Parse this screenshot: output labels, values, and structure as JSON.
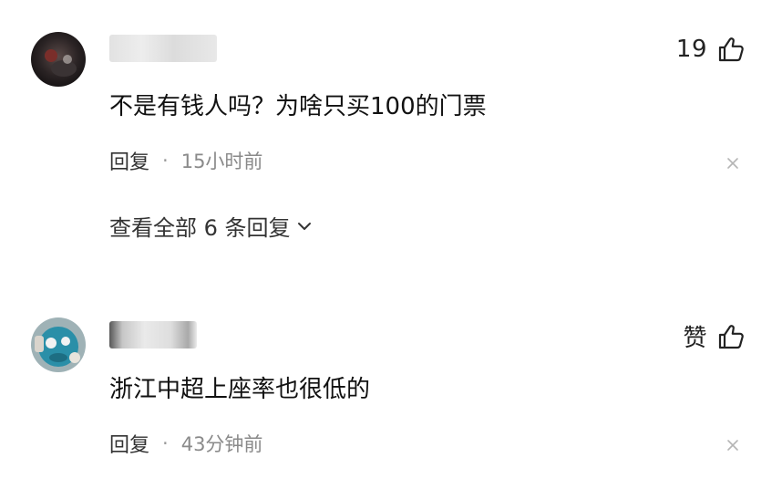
{
  "comments": [
    {
      "like_count": "19",
      "text": "不是有钱人吗？为啥只买100的门票",
      "reply_label": "回复",
      "dot": "·",
      "time": "15小时前",
      "view_replies": "查看全部 6 条回复"
    },
    {
      "like_label": "赞",
      "text": "浙江中超上座率也很低的",
      "reply_label": "回复",
      "dot": "·",
      "time": "43分钟前"
    }
  ],
  "icons": {
    "like": "thumbs-up-icon",
    "close": "close-icon",
    "expand": "chevron-down-icon"
  },
  "colors": {
    "text": "#111111",
    "meta": "#8a8a8a",
    "background": "#ffffff"
  }
}
